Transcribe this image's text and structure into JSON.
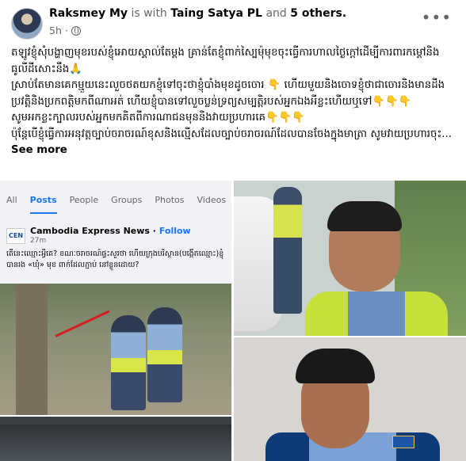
{
  "post": {
    "author": "Raksmey My",
    "with_prefix": "is with",
    "tagged": "Taing Satya PL",
    "and_word": "and",
    "others": "5 others.",
    "time": "5h",
    "more_label": "•••",
    "text_lines": [
      "តឡូវខ្ញុំសុំបង្ហាញមុខរបស់ខ្ញុំអោយស្គាល់តែម្តង គ្រាន់តែខ្ញុំពាក់ស្បៃម៉ុមុខចុះធ្វើការហាលថ្ងៃក្តៅដើម្បីការពារកម្តៅនិងធូលីដីសោះនឹង🙏",
      "ស្រាប់តែមានគេកម្មួយនេះលួចថតយកខ្ញុំទៅចុះថាខ្ញុំបាំងមុខដូចចោរ 👇 ហើយមួយនិងចោទខ្ញុំថាជាចោរនិងមានដីងប្រវត្តិនិងប្រកពត្តិមកពីណាអត់ ហើយខ្ញុំបានទៅលួចប្លន់ទ្រព្យសម្បត្តិរបស់អ្នកឯងអីខ្លះហើយឬទៅ👇👇👇",
      "សូមអកខ្លះក្បាលរបស់អ្នកមកគិតពីការណាជនមុននិងវាយប្រហារគេ👇👇👇",
      "ប៉ុន្តែបើខ្ញុំធ្វើការអនុវត្តច្បាប់ចរាចរណ៍ខុសនិងល្មើសដែលច្បាប់ចរាចរណ៍ដែលបានចែងក្នុងមាត្រា សូមវាយប្រហារចុះ..."
    ],
    "see_more": "See more"
  },
  "screenshot": {
    "tabs": [
      "All",
      "Posts",
      "People",
      "Groups",
      "Photos",
      "Videos",
      "P"
    ],
    "active_tab": "Posts",
    "page_logo": "CEN",
    "page_name": "Cambodia Express News",
    "follow": "Follow",
    "time": "27m",
    "caption": "តើនេះឈ្មោះអ្វីគេ? ខណៈចរាចរណ៍ផ្ទះសួរថា ហើយក្រុងបរិស្ថាន(បង្កើតឈ្មោះ)ខ្ញុំបានរង «ឃុំ» មុខ ពាក់ដែលភ្ជាប់ នៅខ្លួនដោយ?"
  },
  "colors": {
    "accent": "#1877f2",
    "muted": "#65676b",
    "text": "#050505"
  }
}
